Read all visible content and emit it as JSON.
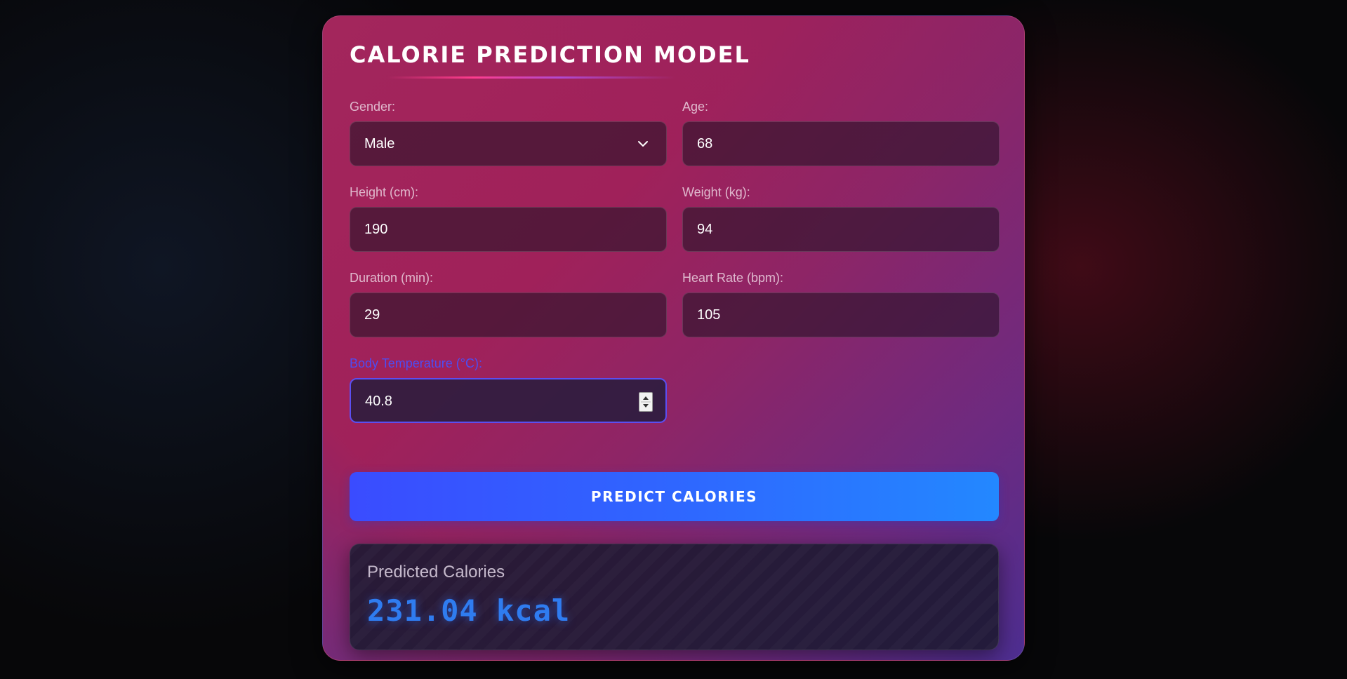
{
  "title": "Calorie Prediction Model",
  "form": {
    "gender": {
      "label": "Gender:",
      "value": "Male"
    },
    "age": {
      "label": "Age:",
      "value": "68"
    },
    "height": {
      "label": "Height (cm):",
      "value": "190"
    },
    "weight": {
      "label": "Weight (kg):",
      "value": "94"
    },
    "duration": {
      "label": "Duration (min):",
      "value": "29"
    },
    "heart_rate": {
      "label": "Heart Rate (bpm):",
      "value": "105"
    },
    "body_temp": {
      "label": "Body Temperature (°C):",
      "value": "40.8"
    }
  },
  "predict_button": "PREDICT CALORIES",
  "result": {
    "label": "Predicted Calories",
    "value": "231.04 kcal"
  },
  "icons": {
    "select": "chevron-down-icon",
    "stepper": "number-spinner-icon"
  },
  "colors": {
    "button_start": "#3a4cff",
    "button_end": "#2388ff",
    "result_value": "#2f7cf0",
    "focus_border": "#5b4ff0"
  }
}
